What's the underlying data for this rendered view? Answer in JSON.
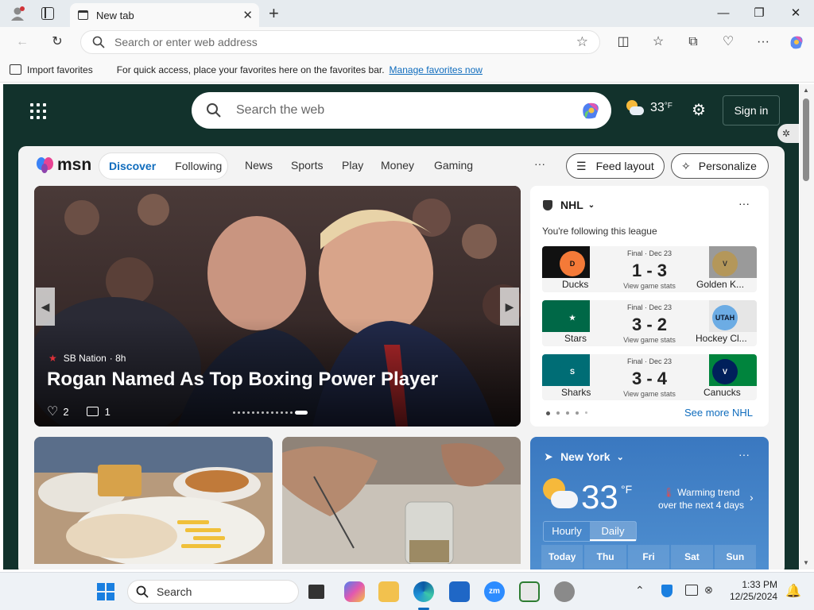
{
  "browser": {
    "tab_title": "New tab",
    "address_placeholder": "Search or enter web address",
    "favorites": {
      "import_label": "Import favorites",
      "message": "For quick access, place your favorites here on the favorites bar.",
      "manage_link": "Manage favorites now"
    }
  },
  "newtab": {
    "search_placeholder": "Search the web",
    "temperature": "33",
    "temp_unit": "°F",
    "sign_in": "Sign in"
  },
  "msn": {
    "logo": "msn",
    "tabs": [
      "Discover",
      "Following"
    ],
    "nav": [
      "News",
      "Sports",
      "Play",
      "Money",
      "Gaming"
    ],
    "more": "···",
    "feed_layout": "Feed layout",
    "personalize": "Personalize"
  },
  "hero": {
    "source": "SB Nation",
    "age": "· 8h",
    "headline": "Rogan Named As Top Boxing Power Player",
    "likes": "2",
    "comments": "1"
  },
  "nhl": {
    "league": "NHL",
    "following_note": "You're following this league",
    "games": [
      {
        "status": "Final · Dec 23",
        "score": "1 - 3",
        "home": "Ducks",
        "away": "Golden K...",
        "stats": "View game stats"
      },
      {
        "status": "Final · Dec 23",
        "score": "3 - 2",
        "home": "Stars",
        "away": "Hockey Cl...",
        "stats": "View game stats"
      },
      {
        "status": "Final · Dec 23",
        "score": "3 - 4",
        "home": "Sharks",
        "away": "Canucks",
        "stats": "View game stats"
      }
    ],
    "see_more": "See more NHL"
  },
  "weather": {
    "location": "New York",
    "temp": "33",
    "unit": "°F",
    "trend_title": "Warming trend",
    "trend_sub": "over the next 4 days",
    "tabs": [
      "Hourly",
      "Daily"
    ],
    "days": [
      "Today",
      "Thu",
      "Fri",
      "Sat",
      "Sun"
    ]
  },
  "taskbar": {
    "search_label": "Search",
    "time": "1:33 PM",
    "date": "12/25/2024"
  },
  "colors": {
    "page_bg": "#12322c",
    "accent": "#0f6cbd",
    "weather_card": "#3a78c0"
  }
}
